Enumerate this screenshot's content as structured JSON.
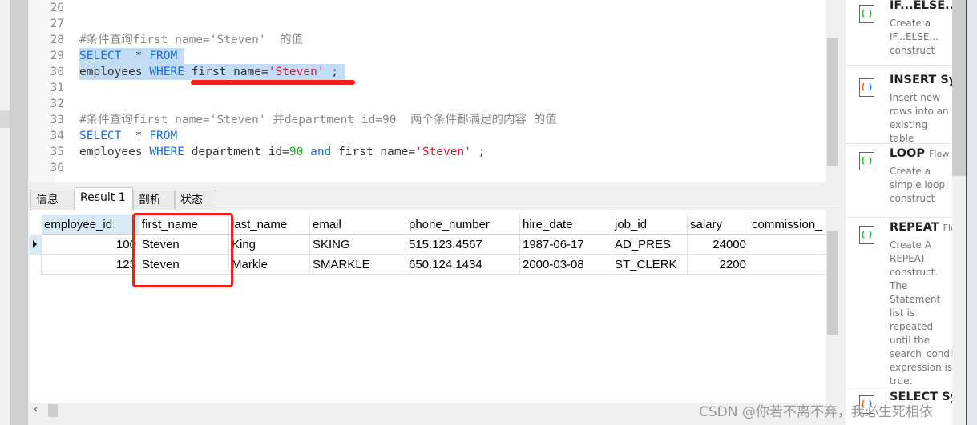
{
  "editor": {
    "lines": [
      {
        "n": "26",
        "parts": []
      },
      {
        "n": "27",
        "parts": []
      },
      {
        "n": "28",
        "parts": [
          {
            "c": "cm",
            "t": "#条件查询first_name='Steven'  的值"
          }
        ]
      },
      {
        "n": "29",
        "sel": true,
        "parts": [
          {
            "c": "kw",
            "t": "SELECT"
          },
          {
            "c": "",
            "t": "  * "
          },
          {
            "c": "kw",
            "t": "FROM"
          },
          {
            "c": "",
            "t": " "
          }
        ]
      },
      {
        "n": "30",
        "sel": true,
        "parts": [
          {
            "c": "",
            "t": "employees "
          },
          {
            "c": "kw",
            "t": "WHERE"
          },
          {
            "c": "",
            "t": " first_name="
          },
          {
            "c": "str",
            "t": "'Steven'"
          },
          {
            "c": "",
            "t": " ; "
          }
        ]
      },
      {
        "n": "31",
        "parts": []
      },
      {
        "n": "32",
        "parts": []
      },
      {
        "n": "33",
        "parts": [
          {
            "c": "cm",
            "t": "#条件查询first_name='Steven' 并department_id=90  两个条件都满足的内容 的值"
          }
        ]
      },
      {
        "n": "34",
        "parts": [
          {
            "c": "kw",
            "t": "SELECT"
          },
          {
            "c": "",
            "t": "  * "
          },
          {
            "c": "kw",
            "t": "FROM"
          }
        ]
      },
      {
        "n": "35",
        "parts": [
          {
            "c": "",
            "t": "employees "
          },
          {
            "c": "kw",
            "t": "WHERE"
          },
          {
            "c": "",
            "t": " department_id="
          },
          {
            "c": "num",
            "t": "90"
          },
          {
            "c": "",
            "t": " "
          },
          {
            "c": "kw",
            "t": "and"
          },
          {
            "c": "",
            "t": " first_name="
          },
          {
            "c": "str",
            "t": "'Steven'"
          },
          {
            "c": "",
            "t": " ;"
          }
        ]
      },
      {
        "n": "36",
        "parts": []
      }
    ]
  },
  "tabs": [
    {
      "label": "信息"
    },
    {
      "label": "Result 1",
      "active": true
    },
    {
      "label": "剖析"
    },
    {
      "label": "状态"
    }
  ],
  "grid": {
    "columns": [
      "employee_id",
      "first_name",
      "last_name",
      "email",
      "phone_number",
      "hire_date",
      "job_id",
      "salary",
      "commission_"
    ],
    "rows": [
      [
        "100",
        "Steven",
        "King",
        "SKING",
        "515.123.4567",
        "1987-06-17",
        "AD_PRES",
        "24000",
        ""
      ],
      [
        "123",
        "Steven",
        "Markle",
        "SMARKLE",
        "650.124.1434",
        "2000-03-08",
        "ST_CLERK",
        "2200",
        ""
      ]
    ]
  },
  "snippets": [
    {
      "title": "IF...ELSE...",
      "sub": "",
      "desc": "Create a IF...ELSE... construct",
      "icon": "green"
    },
    {
      "title": "INSERT Sy",
      "sub": "",
      "desc": "Insert new rows into an existing table",
      "icon": "multi"
    },
    {
      "title": "LOOP",
      "sub": "Flow C",
      "desc": "Create a simple loop construct",
      "icon": "green"
    },
    {
      "title": "REPEAT",
      "sub": "Flo",
      "desc": "Create A REPEAT construct. The Statement list is repeated until the search_condi expression is true.",
      "icon": "green"
    },
    {
      "title": "SELECT Sy",
      "sub": "",
      "desc": "",
      "icon": "multi"
    }
  ],
  "watermark": "CSDN @你若不离不弃，我必生死相依",
  "colors": {
    "keyword": "#1a6de0",
    "string": "#e0152e",
    "number": "#12b312",
    "comment": "#888888",
    "selection": "#c3dcf5",
    "annotation": "#ff1a1a"
  }
}
